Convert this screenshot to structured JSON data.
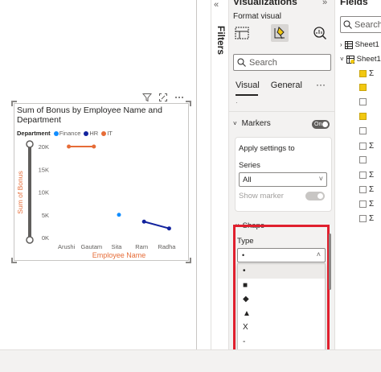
{
  "visualizations": {
    "title": "Visualizations",
    "format_label": "Format visual",
    "search_placeholder": "Search",
    "tabs": [
      "Visual",
      "General"
    ],
    "more": "···",
    "markers_label": "Markers",
    "markers_toggle": "On",
    "apply_label": "Apply settings to",
    "series_label": "Series",
    "series_value": "All",
    "show_marker_label": "Show marker",
    "shape_label": "Shape",
    "type_label": "Type",
    "type_value": "•",
    "type_options": [
      "•",
      "■",
      "◆",
      "▲",
      "X",
      "-",
      "—",
      "+"
    ]
  },
  "filters": {
    "label": "Filters"
  },
  "fields": {
    "title": "Fields",
    "search_placeholder": "Search",
    "tables": [
      "Sheet1",
      "Sheet1"
    ]
  },
  "chart_data": {
    "type": "line",
    "title": "Sum of Bonus by Employee Name and Department",
    "xlabel": "Employee Name",
    "ylabel": "Sum of Bonus",
    "legend_title": "Department",
    "categories": [
      "Arushi",
      "Gautam",
      "Sita",
      "Ram",
      "Radha"
    ],
    "y_ticks": [
      "0K",
      "5K",
      "10K",
      "15K",
      "20K"
    ],
    "ylim": [
      0,
      20000
    ],
    "series": [
      {
        "name": "Finance",
        "color": "#118dff",
        "values": [
          null,
          null,
          5000,
          null,
          null
        ]
      },
      {
        "name": "HR",
        "color": "#12239e",
        "values": [
          null,
          null,
          null,
          3500,
          2000
        ]
      },
      {
        "name": "IT",
        "color": "#e66c37",
        "values": [
          20000,
          20000,
          null,
          null,
          null
        ]
      }
    ],
    "legend_placement": "top-left",
    "grid": false
  },
  "colors": {
    "accent_red": "#e0202e",
    "axis_label": "#e66c37"
  }
}
